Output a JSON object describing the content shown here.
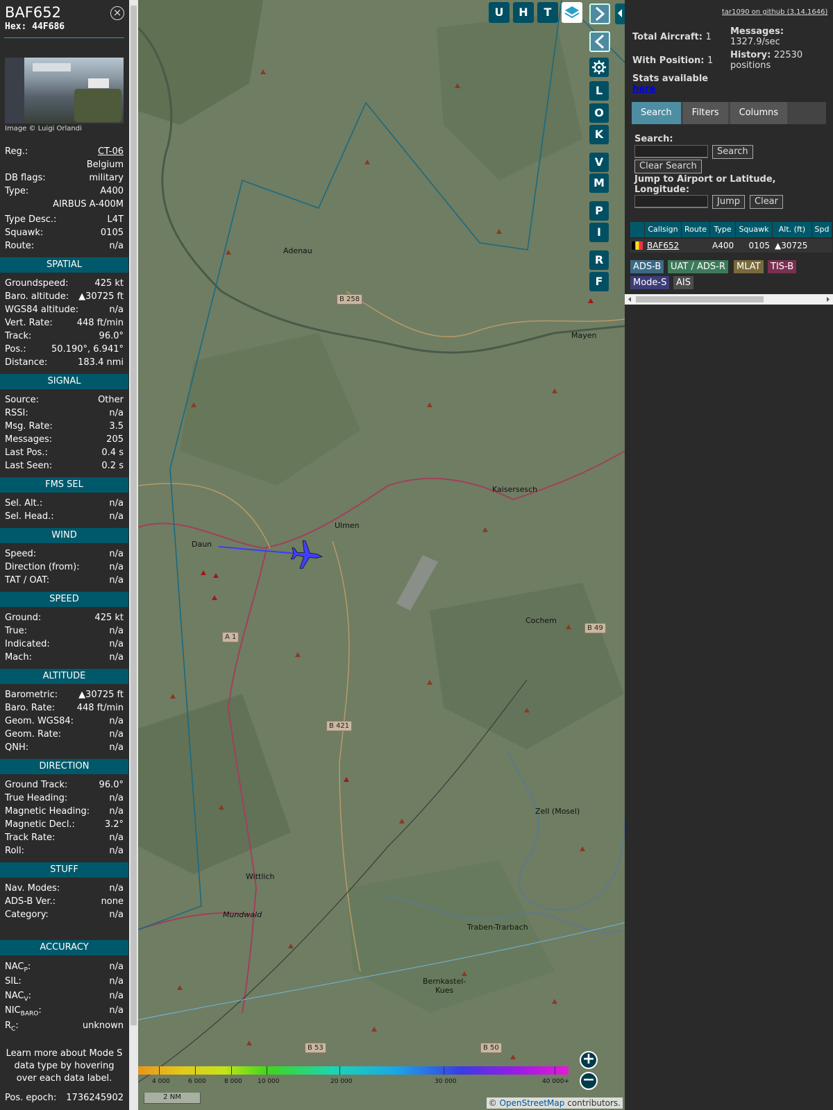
{
  "aircraft": {
    "callsign": "BAF652",
    "hex_label": "Hex:",
    "hex": "44F686",
    "close_symbol": "×",
    "image_credit": "Image © Luigi Orlandi",
    "reg_label": "Reg.:",
    "reg": "CT-06",
    "country": "Belgium",
    "dbflags_label": "DB flags:",
    "dbflags": "military",
    "type_label": "Type:",
    "type": "A400",
    "type_full": "AIRBUS A-400M",
    "typedesc_label": "Type Desc.:",
    "typedesc": "L4T",
    "squawk_label": "Squawk:",
    "squawk": "0105",
    "route_label": "Route:",
    "route": "n/a"
  },
  "sections": {
    "spatial": "SPATIAL",
    "signal": "SIGNAL",
    "fms": "FMS SEL",
    "wind": "WIND",
    "speed": "SPEED",
    "altitude": "ALTITUDE",
    "direction": "DIRECTION",
    "stuff": "STUFF",
    "accuracy": "ACCURACY"
  },
  "spatial": [
    {
      "label": "Groundspeed:",
      "value": "425 kt"
    },
    {
      "label": "Baro. altitude:",
      "value": "▲30725 ft"
    },
    {
      "label": "WGS84 altitude:",
      "value": "n/a"
    },
    {
      "label": "Vert. Rate:",
      "value": "448 ft/min"
    },
    {
      "label": "Track:",
      "value": "96.0°"
    },
    {
      "label": "Pos.:",
      "value": "50.190°, 6.941°"
    },
    {
      "label": "Distance:",
      "value": "183.4 nmi"
    }
  ],
  "signal": [
    {
      "label": "Source:",
      "value": "Other"
    },
    {
      "label": "RSSI:",
      "value": "n/a"
    },
    {
      "label": "Msg. Rate:",
      "value": "3.5"
    },
    {
      "label": "Messages:",
      "value": "205"
    },
    {
      "label": "Last Pos.:",
      "value": "0.4 s"
    },
    {
      "label": "Last Seen:",
      "value": "0.2 s"
    }
  ],
  "fms": [
    {
      "label": "Sel. Alt.:",
      "value": "n/a"
    },
    {
      "label": "Sel. Head.:",
      "value": "n/a"
    }
  ],
  "wind": [
    {
      "label": "Speed:",
      "value": "n/a"
    },
    {
      "label": "Direction (from):",
      "value": "n/a"
    },
    {
      "label": "TAT / OAT:",
      "value": "n/a"
    }
  ],
  "speed": [
    {
      "label": "Ground:",
      "value": "425 kt"
    },
    {
      "label": "True:",
      "value": "n/a"
    },
    {
      "label": "Indicated:",
      "value": "n/a"
    },
    {
      "label": "Mach:",
      "value": "n/a"
    }
  ],
  "altitude": [
    {
      "label": "Barometric:",
      "value": "▲30725 ft"
    },
    {
      "label": "Baro. Rate:",
      "value": "448 ft/min"
    },
    {
      "label": "Geom. WGS84:",
      "value": "n/a"
    },
    {
      "label": "Geom. Rate:",
      "value": "n/a"
    },
    {
      "label": "QNH:",
      "value": "n/a"
    }
  ],
  "direction": [
    {
      "label": "Ground Track:",
      "value": "96.0°"
    },
    {
      "label": "True Heading:",
      "value": "n/a"
    },
    {
      "label": "Magnetic Heading:",
      "value": "n/a"
    },
    {
      "label": "Magnetic Decl.:",
      "value": "3.2°"
    },
    {
      "label": "Track Rate:",
      "value": "n/a"
    },
    {
      "label": "Roll:",
      "value": "n/a"
    }
  ],
  "stuff": [
    {
      "label": "Nav. Modes:",
      "value": "n/a"
    },
    {
      "label": "ADS-B Ver.:",
      "value": "none"
    },
    {
      "label": "Category:",
      "value": "n/a"
    }
  ],
  "accuracy": {
    "nacp_label": "NAC",
    "nacp_sub": "P",
    "nacp": "n/a",
    "sil_label": "SIL:",
    "sil": "n/a",
    "nacv_label": "NAC",
    "nacv_sub": "V",
    "nacv": "n/a",
    "nicbaro_label": "NIC",
    "nicbaro_sub": "BARO",
    "nicbaro": "n/a",
    "rc_label": "R",
    "rc_sub": "C",
    "rc": "unknown"
  },
  "note": "Learn more about Mode S data type by hovering over each data label.",
  "epoch_label": "Pos. epoch:",
  "epoch": "1736245902",
  "map": {
    "toolbar_top": [
      "U",
      "H",
      "T"
    ],
    "toolbar_side": [
      "L",
      "O",
      "K",
      "V",
      "M",
      "P",
      "I",
      "R",
      "F"
    ],
    "places": {
      "adenau": "Adenau",
      "mayen": "Mayen",
      "kaisersesch": "Kaisersesch",
      "ulmen": "Ulmen",
      "daun": "Daun",
      "cochem": "Cochem",
      "zell": "Zell (Mosel)",
      "wittlich": "Wittlich",
      "mundwald": "Mundwald",
      "traben": "Traben-Trarbach",
      "bernkastel": "Bernkastel-\nKues"
    },
    "roads": {
      "b258": "B 258",
      "b49": "B 49",
      "a1": "A 1",
      "b421": "B 421",
      "b53": "B 53",
      "b50": "B 50"
    },
    "altitude_scale": [
      "4 000",
      "6 000",
      "8 000",
      "10 000",
      "20 000",
      "30 000",
      "40 000+"
    ],
    "distance_scale": "2 NM",
    "zoom_in": "+",
    "zoom_out": "−",
    "attribution_prefix": "© ",
    "attribution_link": "OpenStreetMap",
    "attribution_suffix": " contributors."
  },
  "panel": {
    "github": "tar1090 on github (3.14.1646)",
    "total_label": "Total Aircraft:",
    "total": "1",
    "withpos_label": "With Position:",
    "withpos": "1",
    "messages_label": "Messages:",
    "messages": "1327.9/sec",
    "history_label": "History:",
    "history": "22530 positions",
    "stats_label": "Stats available",
    "stats_link": "here",
    "tabs": [
      "Search",
      "Filters",
      "Columns"
    ],
    "search_label": "Search:",
    "search_button": "Search",
    "clear_search": "Clear Search",
    "jump_label": "Jump to Airport or Latitude, Longitude:",
    "jump_button": "Jump",
    "clear_button": "Clear",
    "columns": [
      "Callsign",
      "Route",
      "Type",
      "Squawk",
      "Alt. (ft)",
      "Spd"
    ],
    "row": {
      "callsign": "BAF652",
      "route": "",
      "type": "A400",
      "squawk": "0105",
      "alt": "▲30725"
    },
    "legend": [
      "ADS-B",
      "UAT / ADS-R",
      "MLAT",
      "TIS-B",
      "Mode-S",
      "AIS"
    ]
  }
}
